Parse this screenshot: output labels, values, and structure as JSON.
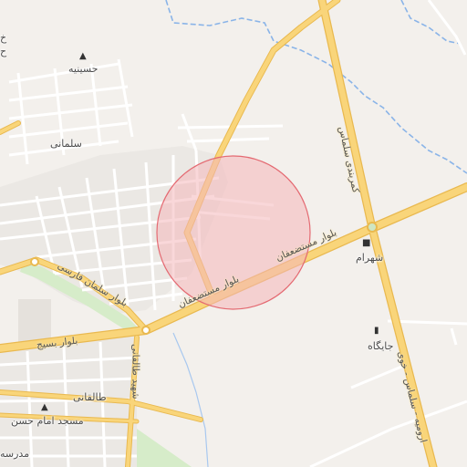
{
  "map": {
    "places": {
      "hosseiniyeh": "حسینیه",
      "salmani": "سلمانی",
      "shahram": "شهرام",
      "jaygah": "جایگاه",
      "taleghani": "طالقانی",
      "masjid": "مسجد امام حسن",
      "madreseh": "مدرسه",
      "partial_top_left_1": "خ",
      "partial_top_left_2": "ح"
    },
    "roads": {
      "mostazafan_east": "بلوار مستضعفان",
      "mostazafan_west": "بلوار مستضعفان",
      "salman_farsi": "بلوار سلمان فارسی",
      "basij": "بلوار بسیج",
      "kamarbandi": "کمربندی سلماس",
      "urmia_salmas": "ارومیه - سلماس - خوی",
      "shahid_taleghani": "شهید طالقانی"
    },
    "icons": {
      "hosseiniyeh": "mosque-icon",
      "shahram": "shopping-bag-icon",
      "jaygah": "fuel-station-icon",
      "masjid": "mosque-icon",
      "roundabout": "roundabout-icon"
    },
    "colors": {
      "background": "#f3f0ec",
      "primary_road": "#f9d57a",
      "primary_road_casing": "#e9b950",
      "minor_road": "#ffffff",
      "river": "#8ab4e8",
      "park": "#d6ecc9",
      "highlight_fill": "#f4b7ba",
      "highlight_stroke": "#e46a72"
    }
  }
}
